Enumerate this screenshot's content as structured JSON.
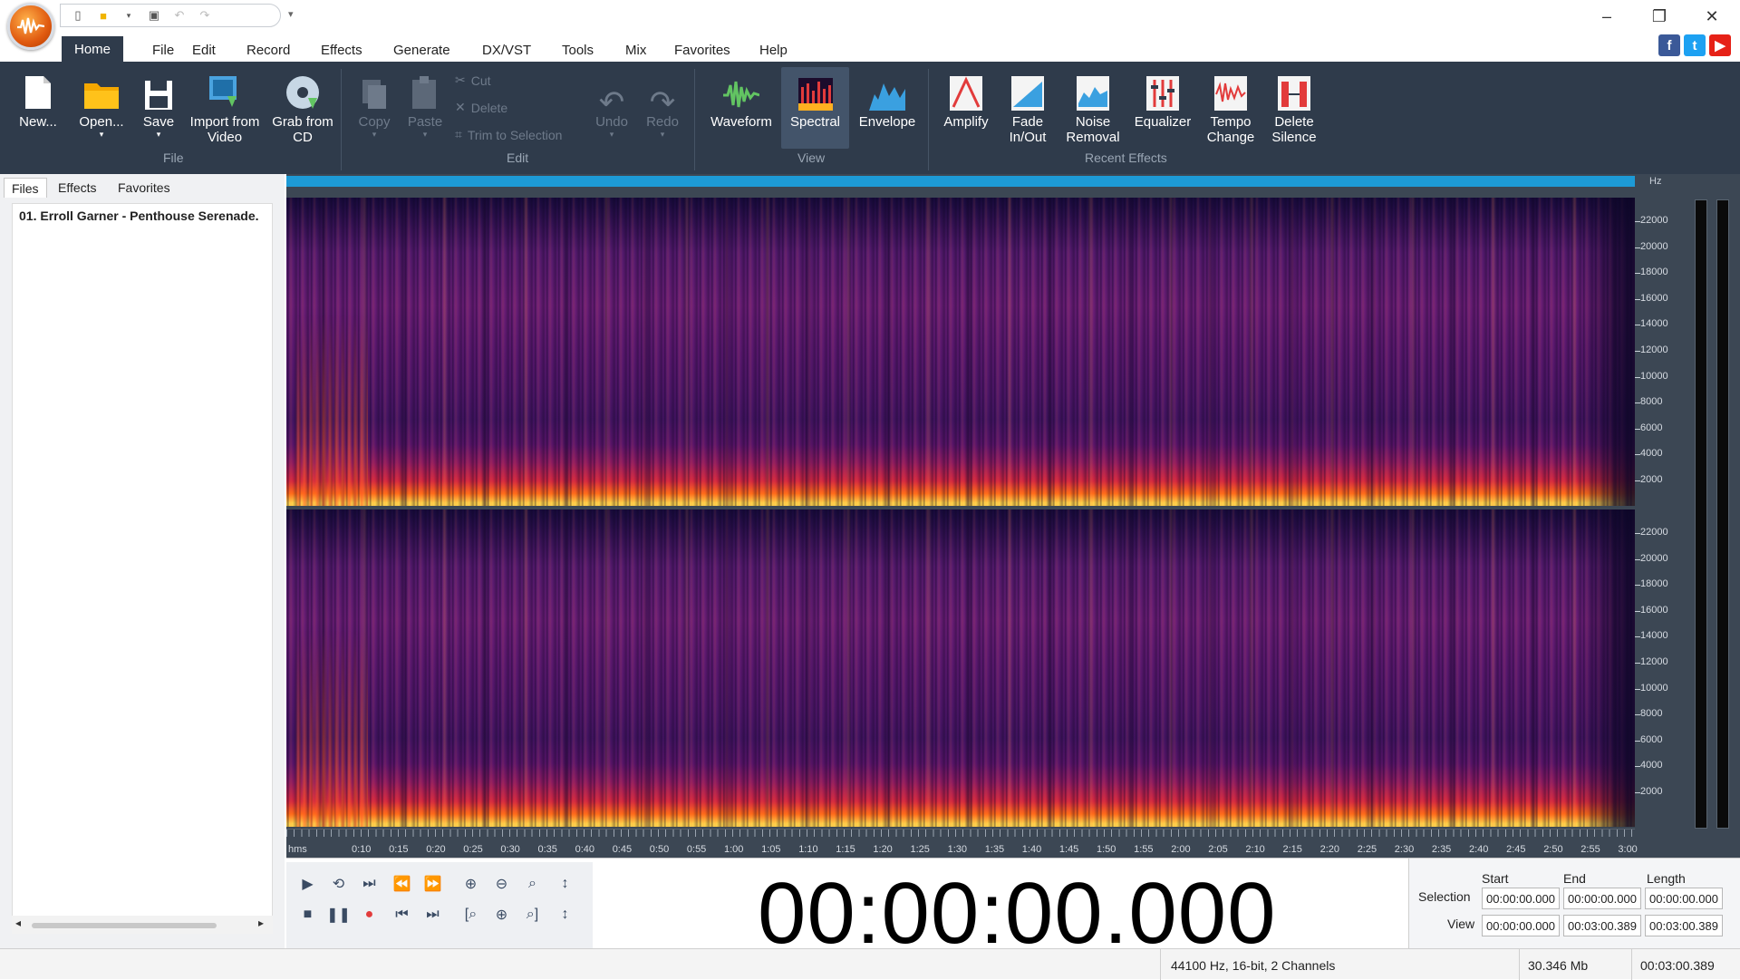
{
  "app": {
    "title_logo": "WavePad"
  },
  "quick_access": {
    "items": [
      "new-doc-icon",
      "open-folder-icon",
      "save-icon",
      "undo-icon",
      "redo-icon"
    ]
  },
  "menu": {
    "tabs": [
      "Home",
      "File",
      "Edit",
      "Record",
      "Effects",
      "Generate",
      "DX/VST",
      "Tools",
      "Mix",
      "Favorites",
      "Help"
    ],
    "active": "Home"
  },
  "ribbon": {
    "file_group": {
      "label": "File",
      "new": "New...",
      "open": "Open...",
      "save": "Save",
      "import_video": "Import from Video",
      "grab_cd": "Grab from CD"
    },
    "edit_group": {
      "label": "Edit",
      "copy": "Copy",
      "paste": "Paste",
      "cut": "Cut",
      "delete": "Delete",
      "trim": "Trim to Selection",
      "undo": "Undo",
      "redo": "Redo"
    },
    "view_group": {
      "label": "View",
      "waveform": "Waveform",
      "spectral": "Spectral",
      "envelope": "Envelope",
      "active": "Spectral"
    },
    "effects_group": {
      "label": "Recent Effects",
      "amplify": "Amplify",
      "fade": "Fade In/Out",
      "noise": "Noise Removal",
      "equalizer": "Equalizer",
      "tempo": "Tempo Change",
      "delete_silence": "Delete Silence"
    }
  },
  "left_panel": {
    "tabs": [
      "Files",
      "Effects",
      "Favorites"
    ],
    "active": "Files",
    "file_item": "01. Erroll Garner - Penthouse Serenade."
  },
  "spectrogram": {
    "unit": "Hz",
    "freq_ticks": [
      "22000",
      "20000",
      "18000",
      "16000",
      "14000",
      "12000",
      "10000",
      "8000",
      "6000",
      "4000",
      "2000"
    ]
  },
  "ruler": {
    "unit": "hms",
    "labels": [
      "0:10",
      "0:15",
      "0:20",
      "0:25",
      "0:30",
      "0:35",
      "0:40",
      "0:45",
      "0:50",
      "0:55",
      "1:00",
      "1:05",
      "1:10",
      "1:15",
      "1:20",
      "1:25",
      "1:30",
      "1:35",
      "1:40",
      "1:45",
      "1:50",
      "1:55",
      "2:00",
      "2:05",
      "2:10",
      "2:15",
      "2:20",
      "2:25",
      "2:30",
      "2:35",
      "2:40",
      "2:45",
      "2:50",
      "2:55",
      "3:00"
    ]
  },
  "transport": {
    "time": "00:00:00.000"
  },
  "selection_panel": {
    "headers": {
      "start": "Start",
      "end": "End",
      "length": "Length"
    },
    "selection": {
      "label": "Selection",
      "start": "00:00:00.000",
      "end": "00:00:00.000",
      "length": "00:00:00.000"
    },
    "view": {
      "label": "View",
      "start": "00:00:00.000",
      "end": "00:03:00.389",
      "length": "00:03:00.389"
    }
  },
  "status": {
    "format": "44100 Hz, 16-bit, 2 Channels",
    "size": "30.346 Mb",
    "duration": "00:03:00.389"
  },
  "colors": {
    "ribbon": "#2f3b4b",
    "timebar": "#1d9ad6",
    "accent": "#e05a10"
  }
}
